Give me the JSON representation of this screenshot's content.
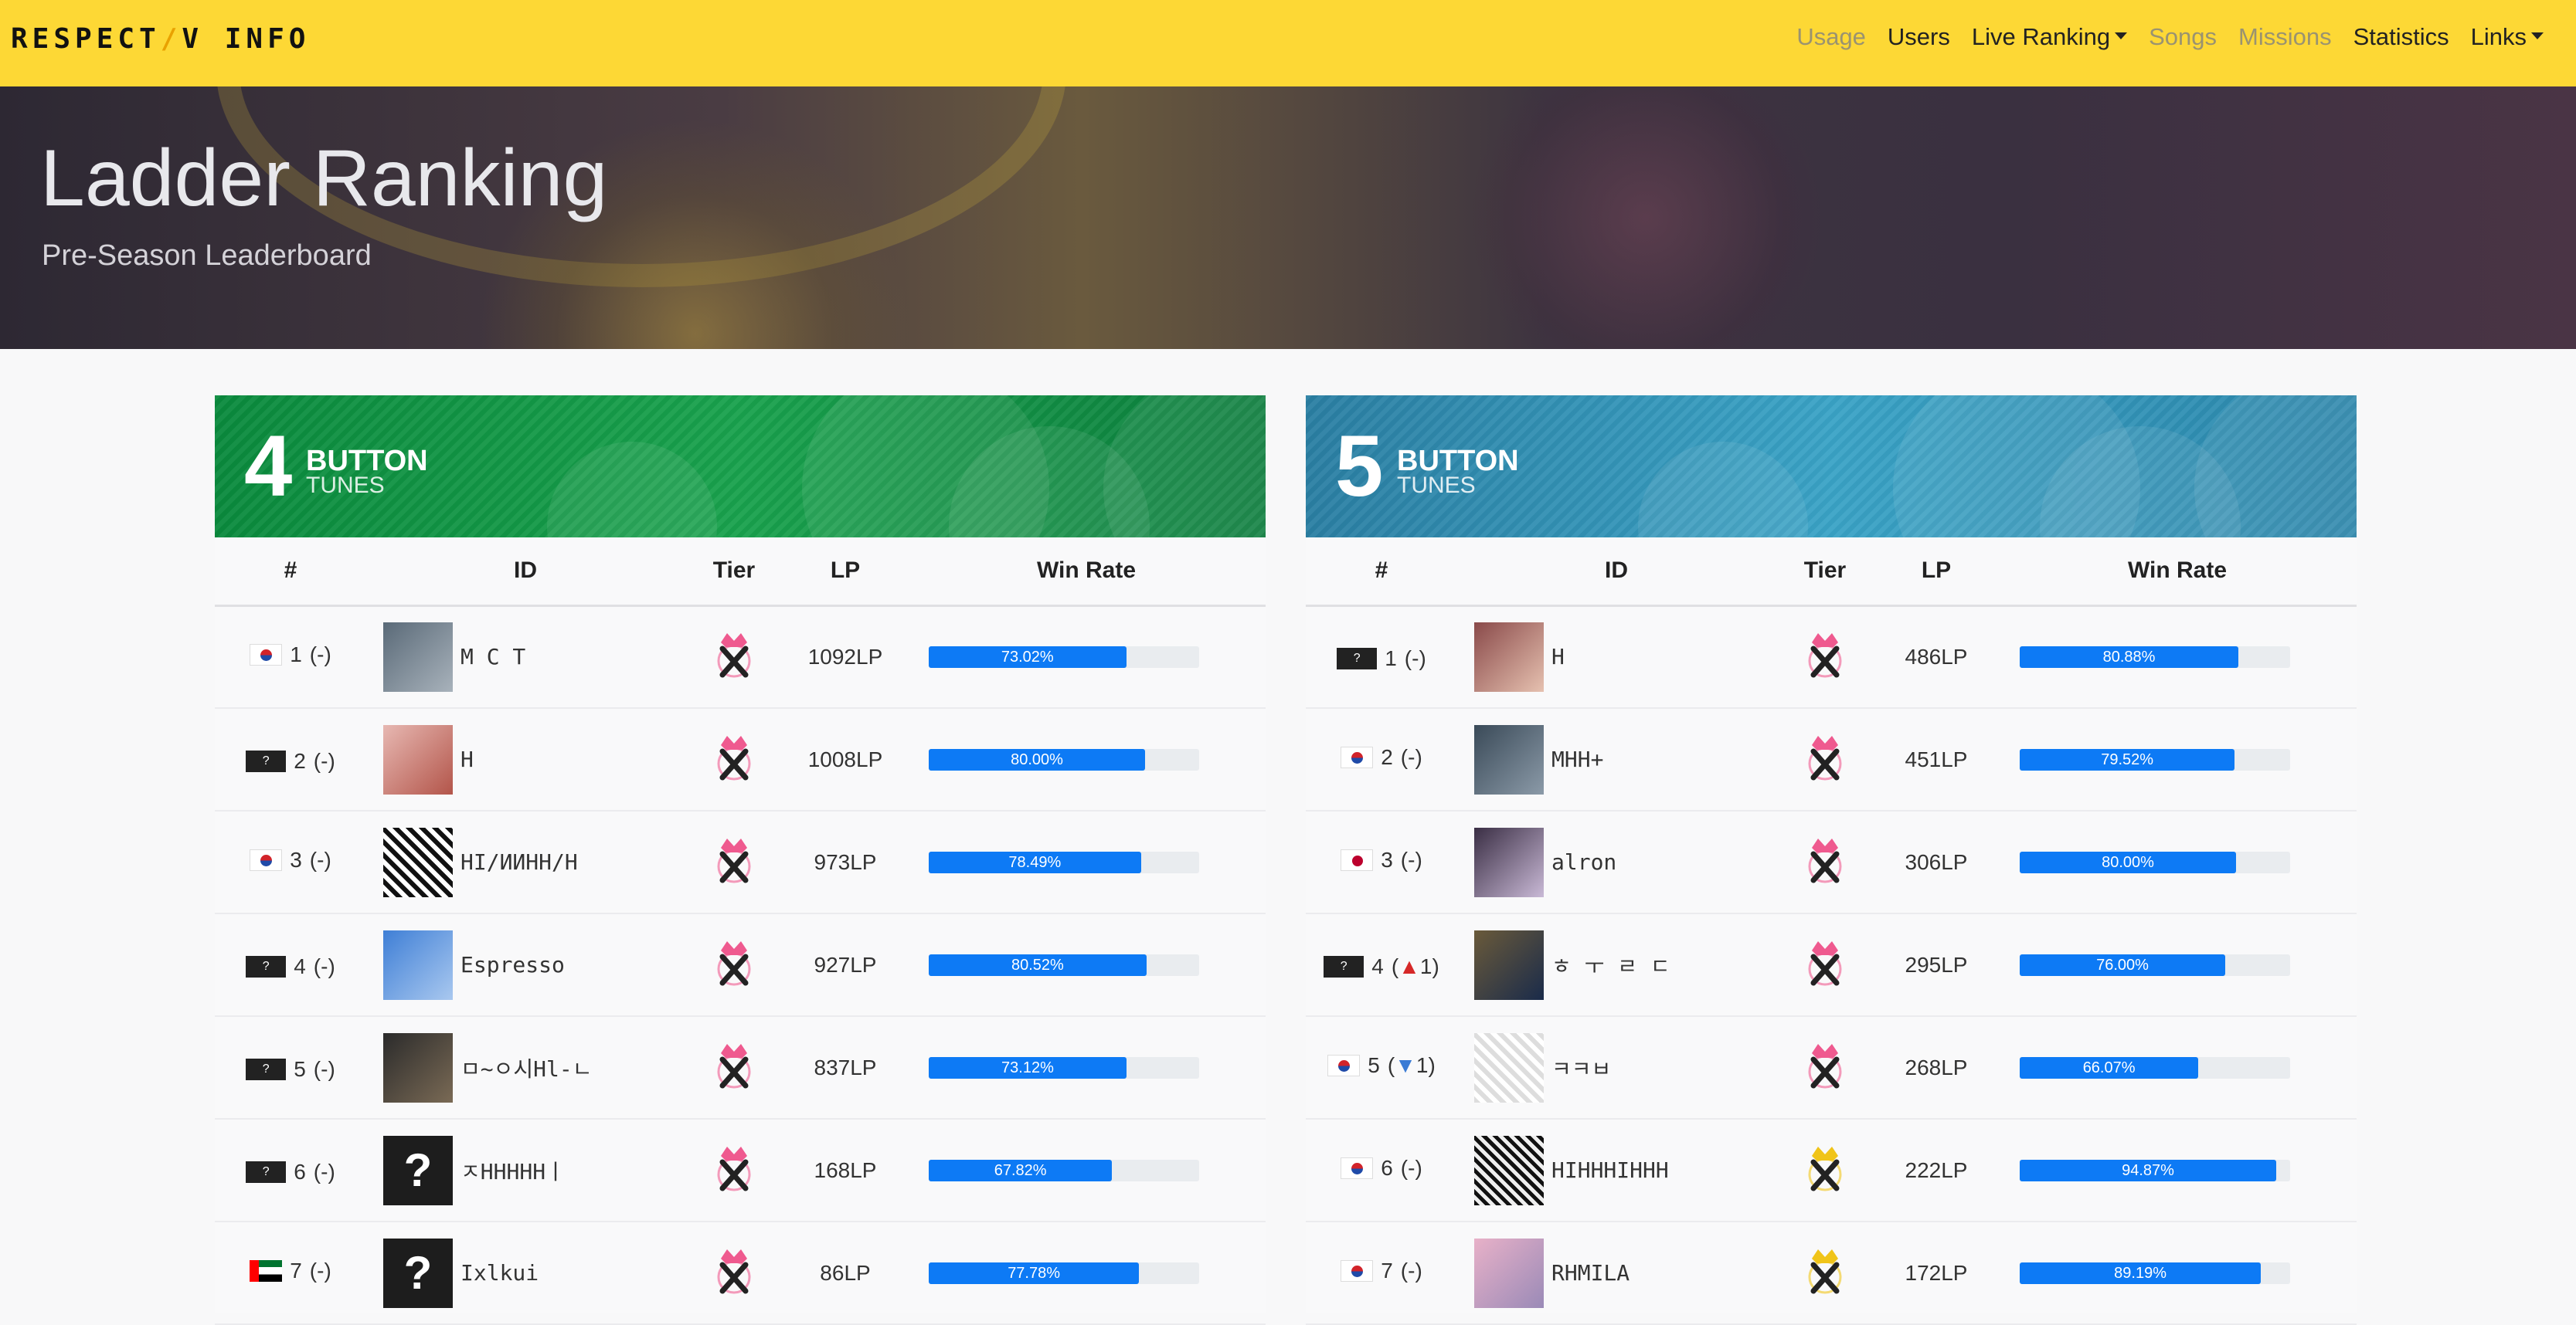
{
  "brand": {
    "name": "RESPECT",
    "slash": "/",
    "suffix": "V INFO"
  },
  "nav": [
    {
      "label": "Usage",
      "muted": true
    },
    {
      "label": "Users",
      "muted": false
    },
    {
      "label": "Live Ranking",
      "muted": false,
      "dropdown": true
    },
    {
      "label": "Songs",
      "muted": true
    },
    {
      "label": "Missions",
      "muted": true
    },
    {
      "label": "Statistics",
      "muted": false
    },
    {
      "label": "Links",
      "muted": false,
      "dropdown": true
    }
  ],
  "hero": {
    "title": "Ladder Ranking",
    "subtitle": "Pre-Season Leaderboard"
  },
  "headers": {
    "rank": "#",
    "id": "ID",
    "tier": "Tier",
    "lp": "LP",
    "win": "Win Rate"
  },
  "panels": [
    {
      "key": "4b",
      "banner": {
        "num": "4",
        "button": "BUTTON",
        "tunes": "TUNES",
        "color": "#0a8a3d"
      },
      "rows": [
        {
          "rank": "1",
          "change": "(-)",
          "flag": "kr",
          "avatar": "av1",
          "name": "M C T",
          "tier": "pink",
          "lp": "1092LP",
          "win": 73.02,
          "win_label": "73.02%"
        },
        {
          "rank": "2",
          "change": "(-)",
          "flag": "unk",
          "avatar": "av2",
          "name": "H",
          "tier": "pink",
          "lp": "1008LP",
          "win": 80.0,
          "win_label": "80.00%"
        },
        {
          "rank": "3",
          "change": "(-)",
          "flag": "kr",
          "avatar": "av3",
          "name": "HI/ИИHH/H",
          "tier": "pink",
          "lp": "973LP",
          "win": 78.49,
          "win_label": "78.49%"
        },
        {
          "rank": "4",
          "change": "(-)",
          "flag": "unk",
          "avatar": "av4",
          "name": "Espresso",
          "tier": "pink",
          "lp": "927LP",
          "win": 80.52,
          "win_label": "80.52%"
        },
        {
          "rank": "5",
          "change": "(-)",
          "flag": "unk",
          "avatar": "av5",
          "name": "ㅁ~ㅇ시Hl-ㄴ",
          "tier": "pink",
          "lp": "837LP",
          "win": 73.12,
          "win_label": "73.12%"
        },
        {
          "rank": "6",
          "change": "(-)",
          "flag": "unk",
          "avatar": "av6",
          "name": "ㅈHHHHHㅣ",
          "tier": "pink",
          "lp": "168LP",
          "win": 67.82,
          "win_label": "67.82%"
        },
        {
          "rank": "7",
          "change": "(-)",
          "flag": "ae",
          "avatar": "av7",
          "name": "Ixlkui",
          "tier": "pink",
          "lp": "86LP",
          "win": 77.78,
          "win_label": "77.78%"
        }
      ]
    },
    {
      "key": "5b",
      "banner": {
        "num": "5",
        "button": "BUTTON",
        "tunes": "TUNES",
        "color": "#2a7fa3"
      },
      "rows": [
        {
          "rank": "1",
          "change": "(-)",
          "flag": "unk",
          "avatar": "av8",
          "name": "H",
          "tier": "pink",
          "lp": "486LP",
          "win": 80.88,
          "win_label": "80.88%"
        },
        {
          "rank": "2",
          "change": "(-)",
          "flag": "kr",
          "avatar": "av9",
          "name": "MHH+",
          "tier": "pink",
          "lp": "451LP",
          "win": 79.52,
          "win_label": "79.52%"
        },
        {
          "rank": "3",
          "change": "(-)",
          "flag": "jp",
          "avatar": "av10",
          "name": "alron",
          "tier": "pink",
          "lp": "306LP",
          "win": 80.0,
          "win_label": "80.00%"
        },
        {
          "rank": "4",
          "change_pre": "(",
          "change_arrow": "▲",
          "change_num": "1",
          "change_post": ")",
          "dir": "up",
          "flag": "unk",
          "avatar": "av11",
          "name": "ㅎ ㅜ ㄹ ㄷ",
          "tier": "pink",
          "lp": "295LP",
          "win": 76.0,
          "win_label": "76.00%"
        },
        {
          "rank": "5",
          "change_pre": "(",
          "change_arrow": "▼",
          "change_num": "1",
          "change_post": ")",
          "dir": "down",
          "flag": "kr",
          "avatar": "av12",
          "name": "ㅋㅋㅂ",
          "tier": "pink",
          "lp": "268LP",
          "win": 66.07,
          "win_label": "66.07%"
        },
        {
          "rank": "6",
          "change": "(-)",
          "flag": "kr",
          "avatar": "av13",
          "name": "HIHHHIHHH",
          "tier": "gold",
          "lp": "222LP",
          "win": 94.87,
          "win_label": "94.87%"
        },
        {
          "rank": "7",
          "change": "(-)",
          "flag": "kr",
          "avatar": "av14",
          "name": "RHMILA",
          "tier": "gold",
          "lp": "172LP",
          "win": 89.19,
          "win_label": "89.19%"
        }
      ]
    }
  ]
}
